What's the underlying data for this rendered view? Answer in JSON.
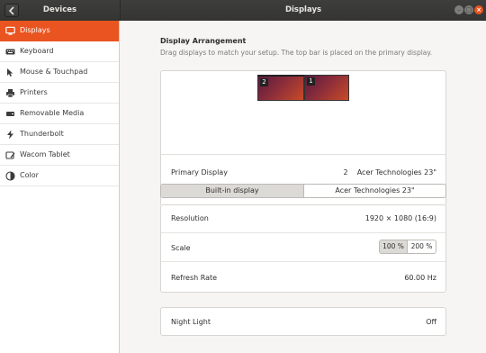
{
  "header": {
    "left_title": "Devices",
    "main_title": "Displays"
  },
  "sidebar": {
    "items": [
      {
        "label": "Displays",
        "icon": "display-icon",
        "active": true
      },
      {
        "label": "Keyboard",
        "icon": "keyboard-icon"
      },
      {
        "label": "Mouse & Touchpad",
        "icon": "mouse-icon"
      },
      {
        "label": "Printers",
        "icon": "printer-icon"
      },
      {
        "label": "Removable Media",
        "icon": "removable-media-icon"
      },
      {
        "label": "Thunderbolt",
        "icon": "thunderbolt-icon"
      },
      {
        "label": "Wacom Tablet",
        "icon": "tablet-icon"
      },
      {
        "label": "Color",
        "icon": "color-icon"
      }
    ]
  },
  "arrangement": {
    "title": "Display Arrangement",
    "subtitle": "Drag displays to match your setup. The top bar is placed on the primary display.",
    "monitor_left_number": "2",
    "monitor_right_number": "1",
    "primary_label": "Primary Display",
    "primary_number": "2",
    "primary_name": "Acer Technologies 23\""
  },
  "display_tabs": {
    "builtin": "Built-in display",
    "external": "Acer Technologies 23\"",
    "selected": "builtin"
  },
  "settings": {
    "resolution_label": "Resolution",
    "resolution_value": "1920 × 1080 (16:9)",
    "scale_label": "Scale",
    "scale_options": [
      "100 %",
      "200 %"
    ],
    "scale_selected": "100 %",
    "refresh_label": "Refresh Rate",
    "refresh_value": "60.00 Hz"
  },
  "night_light": {
    "label": "Night Light",
    "value": "Off"
  },
  "colors": {
    "accent": "#e95420",
    "header_bg": "#3a3a38"
  }
}
